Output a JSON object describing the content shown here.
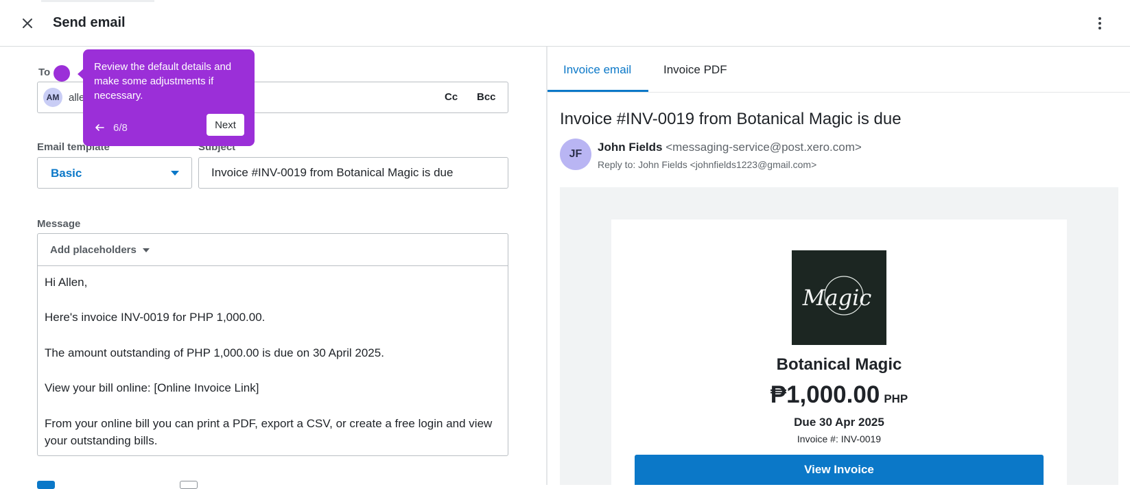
{
  "header": {
    "title": "Send email"
  },
  "form": {
    "to_label": "To",
    "recipient_initials": "AM",
    "recipient_text": "alle",
    "cc_label": "Cc",
    "bcc_label": "Bcc",
    "template_label": "Email template",
    "template_value": "Basic",
    "subject_label": "Subject",
    "subject_value": "Invoice #INV-0019 from Botanical Magic is due",
    "message_label": "Message",
    "add_placeholders_label": "Add placeholders",
    "message_paragraphs": [
      "Hi Allen,",
      "Here's invoice INV-0019 for PHP 1,000.00.",
      "The amount outstanding of PHP 1,000.00 is due on 30 April 2025.",
      "View your bill online: [Online Invoice Link]",
      "From your online bill you can print a PDF, export a CSV, or create a free login and view your outstanding bills."
    ]
  },
  "tour": {
    "text": "Review the default details and make some adjustments if necessary.",
    "step": "6/8",
    "next_label": "Next"
  },
  "preview": {
    "tabs": [
      {
        "label": "Invoice email"
      },
      {
        "label": "Invoice PDF"
      }
    ],
    "email_subject": "Invoice #INV-0019 from Botanical Magic is due",
    "sender_initials": "JF",
    "sender_name": "John Fields",
    "sender_address": "<messaging-service@post.xero.com>",
    "reply_to": "Reply to: John Fields <johnfields1223@gmail.com>",
    "logo_text": "Magic",
    "business_name": "Botanical Magic",
    "amount": "₱1,000.00",
    "currency": "PHP",
    "due": "Due 30 Apr 2025",
    "invoice_number": "Invoice #: INV-0019",
    "view_button": "View Invoice"
  },
  "colors": {
    "accent": "#0b78c8",
    "tour": "#9b2fd8"
  }
}
